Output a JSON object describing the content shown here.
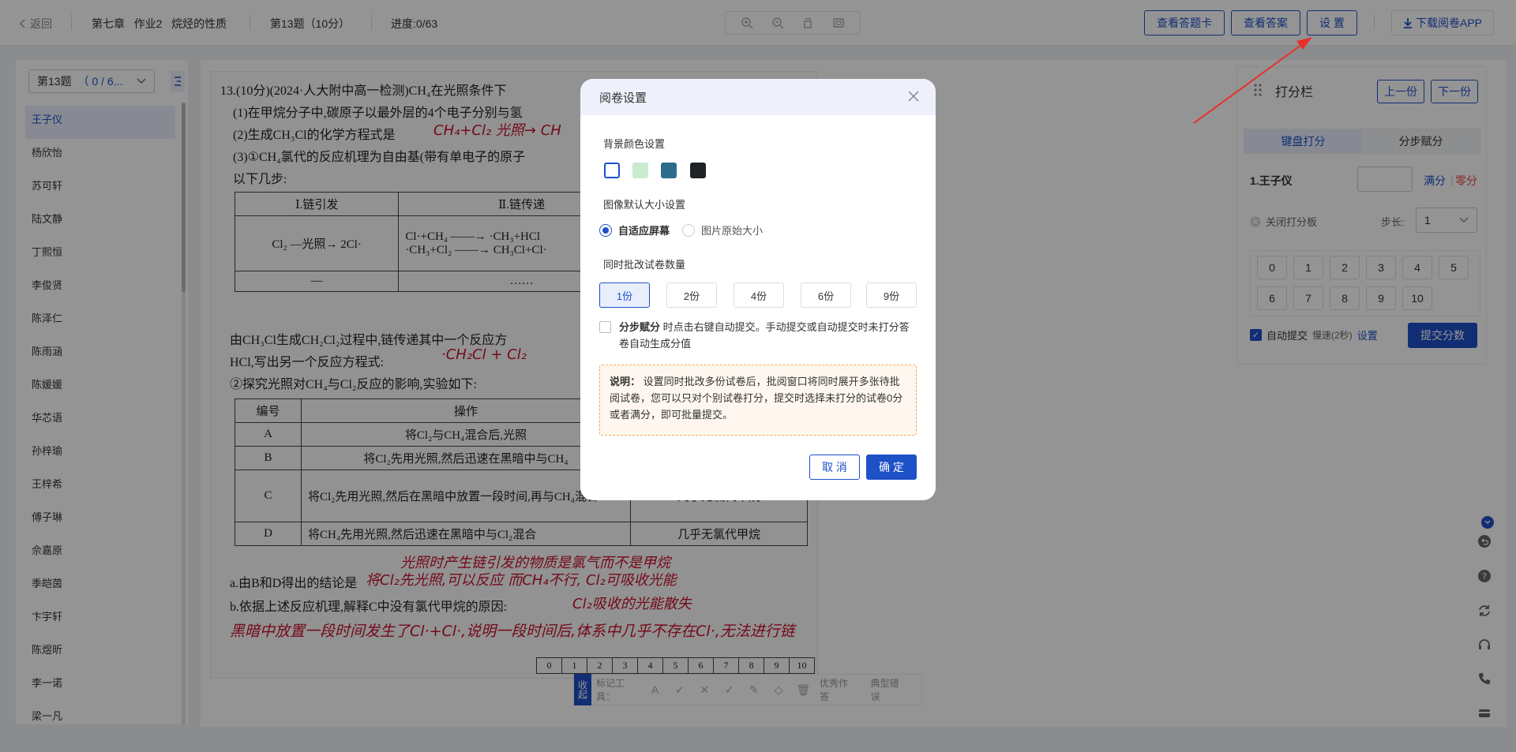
{
  "topbar": {
    "back_label": "返回",
    "breadcrumb": "第七章   作业2   烷烃的性质",
    "question": "第13题（10分）",
    "progress": "进度:0/63",
    "buttons": {
      "answer_card": "查看答题卡",
      "view_answer": "查看答案",
      "settings": "设 置",
      "download_app": "下载阅卷APP"
    },
    "tool_icons": [
      "zoom-in-icon",
      "zoom-out-icon",
      "rotate-icon",
      "fit-icon"
    ]
  },
  "left_panel": {
    "question_select": {
      "label": "第13题",
      "count": "（ 0 / 6..."
    },
    "students": [
      "王子仪",
      "杨欣怡",
      "苏可轩",
      "陆文静",
      "丁熙恒",
      "李俊贤",
      "陈泽仁",
      "陈雨涵",
      "陈媛媛",
      "华芯语",
      "孙梓瑜",
      "王梓希",
      "傅子琳",
      "佘嘉原",
      "季皑茵",
      "卞宇轩",
      "陈煜昕",
      "李一诺",
      "梁一凡"
    ],
    "active_index": 0
  },
  "paper": {
    "lines": [
      "13.(10分)(2024·人大附中高一检测)CH₄在光照条件下",
      "(1)在甲烷分子中,碳原子以最外层的4个电子分别与氢",
      "(2)生成CH₃Cl的化学方程式是",
      "(3)①CH₄氯代的反应机理为自由基(带有单电子的原子",
      "以下几步:",
      "由CH₃Cl生成CH₂Cl₂过程中,链传递其中一个反应方",
      "HCl,写出另一个反应方程式:",
      "②探究光照对CH₄与Cl₂反应的影响,实验如下:",
      "a.由B和D得出的结论是",
      "b.依据上述反应机理,解释C中没有氯代甲烷的原因:"
    ],
    "handwriting": [
      "CH₄+Cl₂ 光照→ CH",
      "·CH₂Cl + Cl₂",
      "光照时产生链引发的物质是氯气而不是甲烷",
      "将Cl₂先光照,可以反应 而CH₄不行, Cl₂可吸收光能",
      "Cl₂吸收的光能散失",
      "黑暗中放置一段时间发生了Cl·+Cl·,说明一段时间后,体系中几乎不存在Cl·,无法进行链"
    ],
    "mech_table": {
      "headers": [
        "Ⅰ.链引发",
        "Ⅱ.链传递"
      ],
      "row1": [
        "Cl₂ —光照→ 2Cl·",
        "Cl·+CH₄ ——→ ·CH₃+HCl\n·CH₃+Cl₂ ——→ CH₃Cl+Cl·"
      ],
      "row2": [
        "—",
        "……"
      ]
    },
    "exp_table": {
      "headers": [
        "编号",
        "操作",
        ""
      ],
      "rows": [
        [
          "A",
          "将Cl₂与CH₄混合后,光照",
          ""
        ],
        [
          "B",
          "将Cl₂先用光照,然后迅速在黑暗中与CH₄",
          ""
        ],
        [
          "C",
          "将Cl₂先用光照,然后在黑暗中放置一段时间,再与CH₄混合",
          "几乎无氯代甲烷"
        ],
        [
          "D",
          "将CH₄先用光照,然后迅速在黑暗中与Cl₂混合",
          "几乎无氯代甲烷"
        ]
      ]
    },
    "score_grid": [
      "0",
      "1",
      "2",
      "3",
      "4",
      "5",
      "6",
      "7",
      "8",
      "9",
      "10"
    ]
  },
  "mark_tools": {
    "collapse": "收起",
    "label": "标记工具：",
    "icons": [
      "text-icon",
      "check-icon",
      "cross-icon",
      "half-check-icon",
      "pen-icon",
      "eraser-icon",
      "trash-icon"
    ],
    "excellent": "优秀作答",
    "typical": "典型错误"
  },
  "score_panel": {
    "title": "打分栏",
    "prev": "上一份",
    "next": "下一份",
    "tabs": [
      "键盘打分",
      "分步赋分"
    ],
    "student": "1.王子仪",
    "full": "满分",
    "zero": "零分",
    "close_board": "关闭打分板",
    "step_label": "步长:",
    "step_value": "1",
    "keys": [
      "0",
      "1",
      "2",
      "3",
      "4",
      "5",
      "6",
      "7",
      "8",
      "9",
      "10"
    ],
    "auto_submit": "自动提交",
    "speed": "慢速(2秒)",
    "speed_setting": "设置",
    "submit": "提交分数"
  },
  "float_icons": [
    "chevron-down-icon",
    "undo-icon",
    "help-icon",
    "refresh-icon",
    "headset-icon",
    "phone-icon",
    "card-icon"
  ],
  "modal": {
    "title": "阅卷设置",
    "bg_section": "背景颜色设置",
    "bg_colors": [
      "#ffffff",
      "#c8ebcf",
      "#2e6b8c",
      "#1f2328"
    ],
    "size_section": "图像默认大小设置",
    "size_options": [
      "自适应屏幕",
      "图片原始大小"
    ],
    "size_selected": 0,
    "count_section": "同时批改试卷数量",
    "count_options": [
      "1份",
      "2份",
      "4份",
      "6份",
      "9份"
    ],
    "count_selected": 0,
    "step_option_bold": "分步赋分",
    "step_option_text": "时点击右键自动提交。手动提交或自动提交时未打分答卷自动生成分值",
    "note_label": "说明：",
    "note_text": "设置同时批改多份试卷后，批阅窗口将同时展开多张待批阅试卷，您可以只对个别试卷打分，提交时选择未打分的试卷0分或者满分，即可批量提交。",
    "cancel": "取 消",
    "confirm": "确 定"
  },
  "colors": {
    "primary": "#1e50c8",
    "danger": "#e44444",
    "annotation": "#e8302a"
  }
}
